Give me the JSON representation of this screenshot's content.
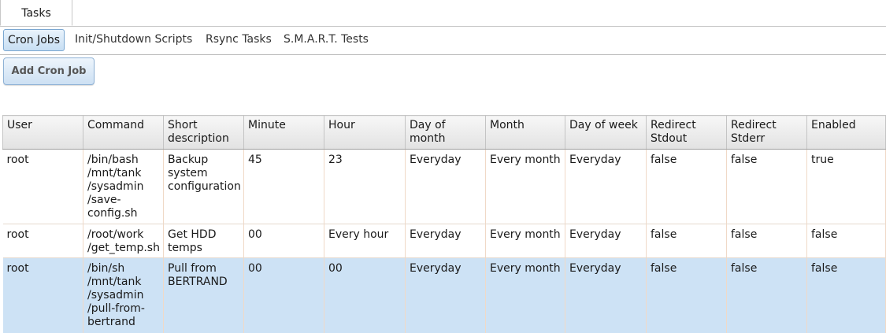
{
  "tabs": {
    "top_label": "Tasks"
  },
  "subtabs": [
    {
      "label": "Cron Jobs",
      "active": true
    },
    {
      "label": "Init/Shutdown Scripts",
      "active": false
    },
    {
      "label": "Rsync Tasks",
      "active": false
    },
    {
      "label": "S.M.A.R.T. Tests",
      "active": false
    }
  ],
  "toolbar": {
    "add_label": "Add Cron Job"
  },
  "table": {
    "headers": [
      "User",
      "Command",
      "Short description",
      "Minute",
      "Hour",
      "Day of month",
      "Month",
      "Day of week",
      "Redirect Stdout",
      "Redirect Stderr",
      "Enabled"
    ],
    "rows": [
      [
        "root",
        "/bin/bash /mnt/tank /sysadmin /save-config.sh",
        "Backup system configuration",
        "45",
        "23",
        "Everyday",
        "Every month",
        "Everyday",
        "false",
        "false",
        "true"
      ],
      [
        "root",
        "/root/work /get_temp.sh",
        "Get HDD temps",
        "00",
        "Every hour",
        "Everyday",
        "Every month",
        "Everyday",
        "false",
        "false",
        "false"
      ],
      [
        "root",
        "/bin/sh /mnt/tank /sysadmin /pull-from-bertrand",
        "Pull from BERTRAND",
        "00",
        "00",
        "Everyday",
        "Every month",
        "Everyday",
        "false",
        "false",
        "false"
      ]
    ],
    "selected_row": 2
  },
  "colors": {
    "selected_row_bg": "#cde2f5",
    "button_border": "#8fb2d6"
  }
}
